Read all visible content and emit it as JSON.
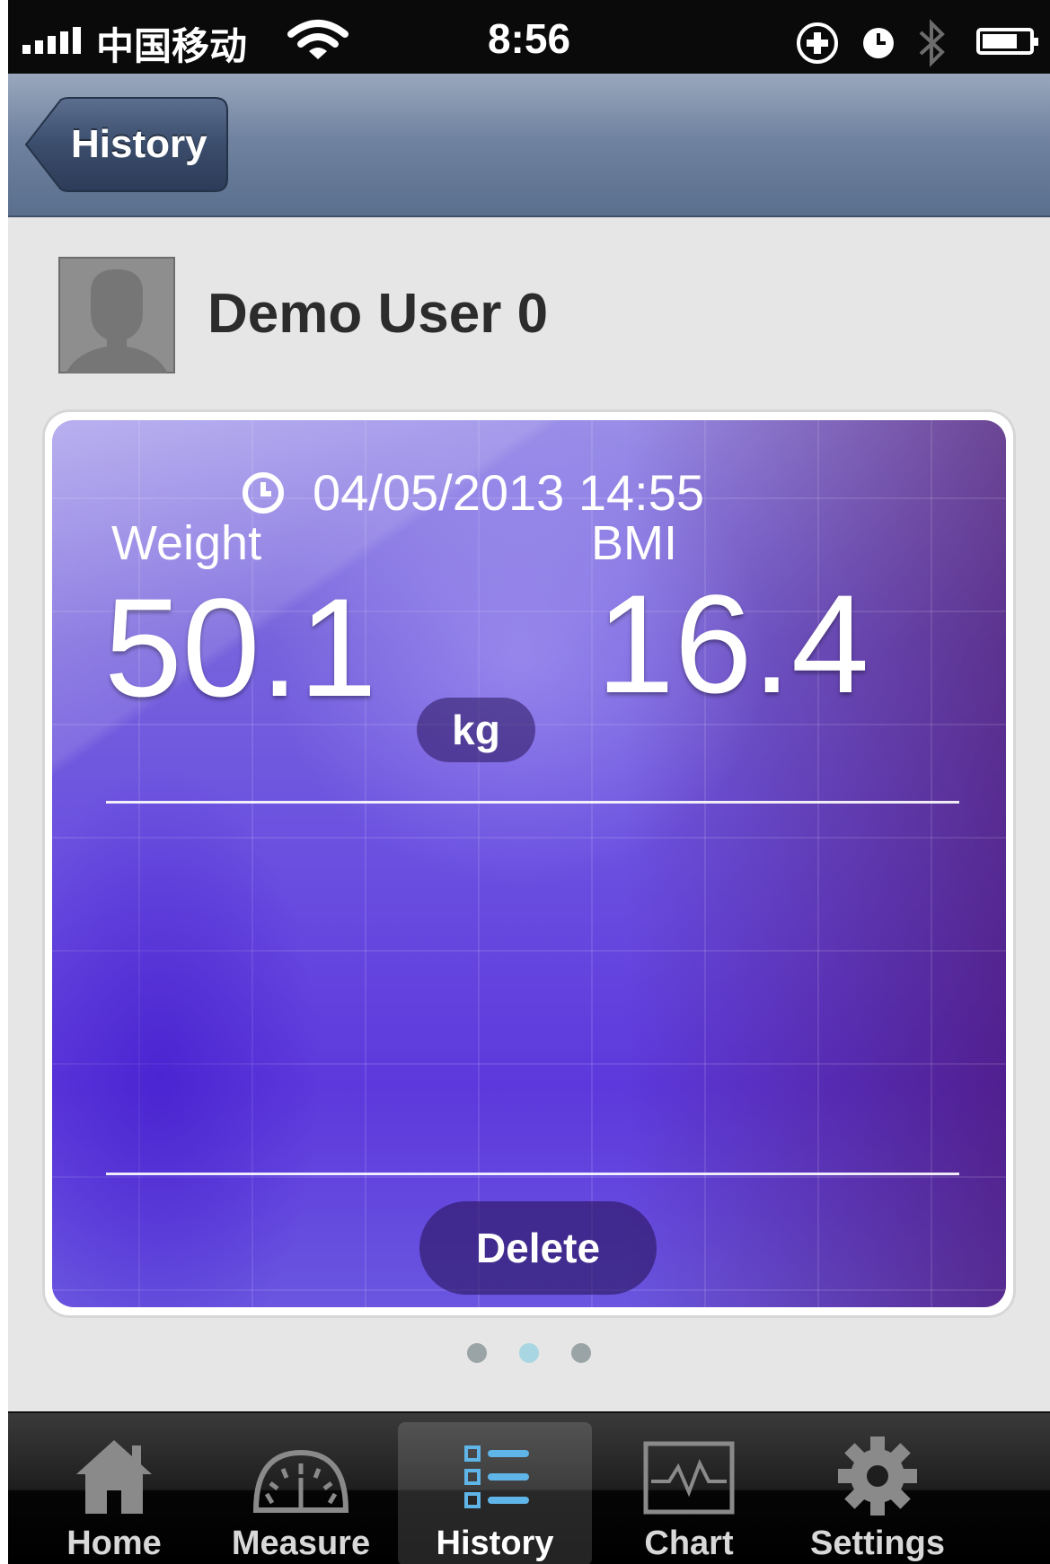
{
  "status_bar": {
    "carrier": "中国移动",
    "time": "8:56"
  },
  "nav": {
    "back_label": "History"
  },
  "user": {
    "name": "Demo User 0"
  },
  "record": {
    "datetime": "04/05/2013 14:55",
    "weight_label": "Weight",
    "weight_value": "50.1",
    "weight_unit": "kg",
    "bmi_label": "BMI",
    "bmi_value": "16.4",
    "delete_label": "Delete"
  },
  "pager": {
    "current_page": 2,
    "page_count": 3
  },
  "tabs": [
    {
      "label": "Home",
      "icon": "house-icon"
    },
    {
      "label": "Measure",
      "icon": "gauge-icon"
    },
    {
      "label": "History",
      "icon": "list-icon",
      "active": true
    },
    {
      "label": "Chart",
      "icon": "chart-icon"
    },
    {
      "label": "Settings",
      "icon": "gear-icon"
    }
  ],
  "colors": {
    "nav_bar": "#7083a0",
    "card_purple": "#6a4fe0",
    "active_dot": "#a8d6e2",
    "history_icon_accent": "#5fb4e8"
  }
}
